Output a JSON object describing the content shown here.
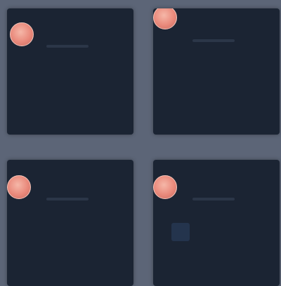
{
  "panels": [
    {
      "title": "",
      "rows": [
        "",
        "",
        ""
      ]
    },
    {
      "title": "",
      "rows": [
        "",
        "",
        ""
      ]
    },
    {
      "title": "",
      "rows": [
        "",
        "",
        ""
      ]
    },
    {
      "title": "",
      "rows": [
        "",
        "",
        ""
      ]
    }
  ],
  "colors": {
    "background": "#5c6577",
    "panel": "#1b2433",
    "avatar": "#e9897b"
  },
  "icons": {
    "avatar": "avatar-icon",
    "tile": "square-icon"
  }
}
